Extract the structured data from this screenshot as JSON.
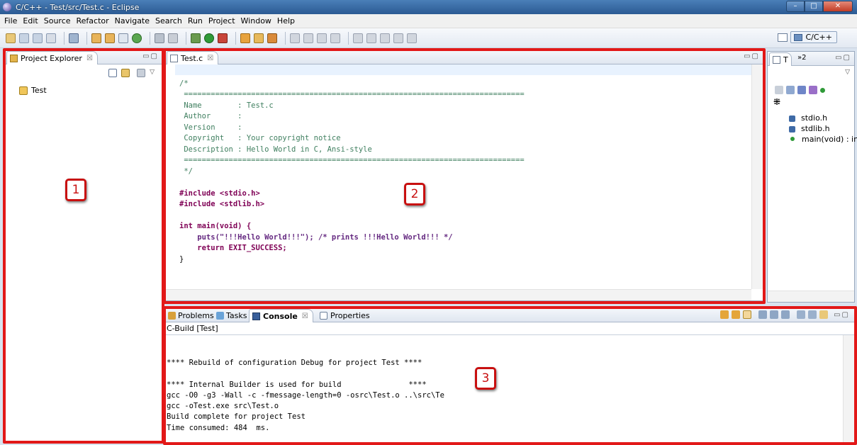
{
  "window": {
    "title": "C/C++ - Test/src/Test.c - Eclipse"
  },
  "menu": [
    "File",
    "Edit",
    "Source",
    "Refactor",
    "Navigate",
    "Search",
    "Run",
    "Project",
    "Window",
    "Help"
  ],
  "perspective": {
    "label": "C/C++"
  },
  "project_explorer": {
    "tab_label": "Project Explorer",
    "close_glyph": "☒",
    "tree": [
      {
        "label": "Test"
      }
    ]
  },
  "editor": {
    "tab_label": "Test.c",
    "close_glyph": "☒",
    "lines": [
      "/*",
      " ============================================================================",
      " Name        : Test.c",
      " Author      :",
      " Version     :",
      " Copyright   : Your copyright notice",
      " Description : Hello World in C, Ansi-style",
      " ============================================================================",
      " */",
      "",
      "#include <stdio.h>",
      "#include <stdlib.h>",
      "",
      "int main(void) {",
      "    puts(\"!!!Hello World!!!\"); /* prints !!!Hello World!!! */",
      "    return EXIT_SUCCESS;",
      "}"
    ]
  },
  "outline": {
    "tab_labels": [
      "T",
      "»2"
    ],
    "items": [
      {
        "label": "stdio.h",
        "icon": "include-icon"
      },
      {
        "label": "stdlib.h",
        "icon": "include-icon"
      },
      {
        "label": "main(void) : in",
        "icon": "function-icon"
      }
    ]
  },
  "bottom_panel": {
    "tabs": [
      {
        "label": "Problems"
      },
      {
        "label": "Tasks"
      },
      {
        "label": "Console",
        "close_glyph": "☒"
      },
      {
        "label": "Properties"
      }
    ],
    "console_title": "C-Build [Test]",
    "console_lines": [
      "",
      "**** Rebuild of configuration Debug for project Test ****",
      "",
      "**** Internal Builder is used for build               ****",
      "gcc -O0 -g3 -Wall -c -fmessage-length=0 -osrc\\Test.o ..\\src\\Te",
      "gcc -oTest.exe src\\Test.o",
      "Build complete for project Test",
      "Time consumed: 484  ms."
    ]
  },
  "annotations": {
    "label_1": "1",
    "label_2": "2",
    "label_3": "3"
  },
  "colors": {
    "highlight": "#e21818",
    "comment": "#3f7f5f",
    "keyword": "#7f0055",
    "string": "#2a00ff"
  }
}
